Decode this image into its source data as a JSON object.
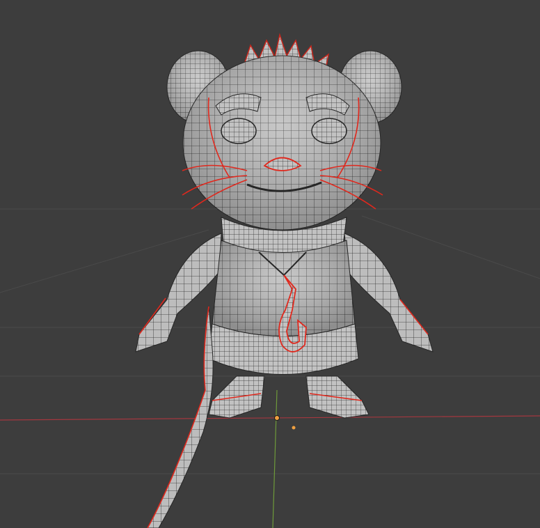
{
  "viewport": {
    "mode": "edit-mode-wireframe",
    "object_icon": "mouse-character-mesh",
    "colors": {
      "background": "#3d3d3d",
      "grid": "#4a4a4a",
      "x_axis": "#a4373f",
      "y_axis": "#6e9a3a",
      "mesh_face": "#bdbdbd",
      "mesh_wire": "#262626",
      "seam": "#e0281d",
      "origin": "#f0a040"
    }
  }
}
